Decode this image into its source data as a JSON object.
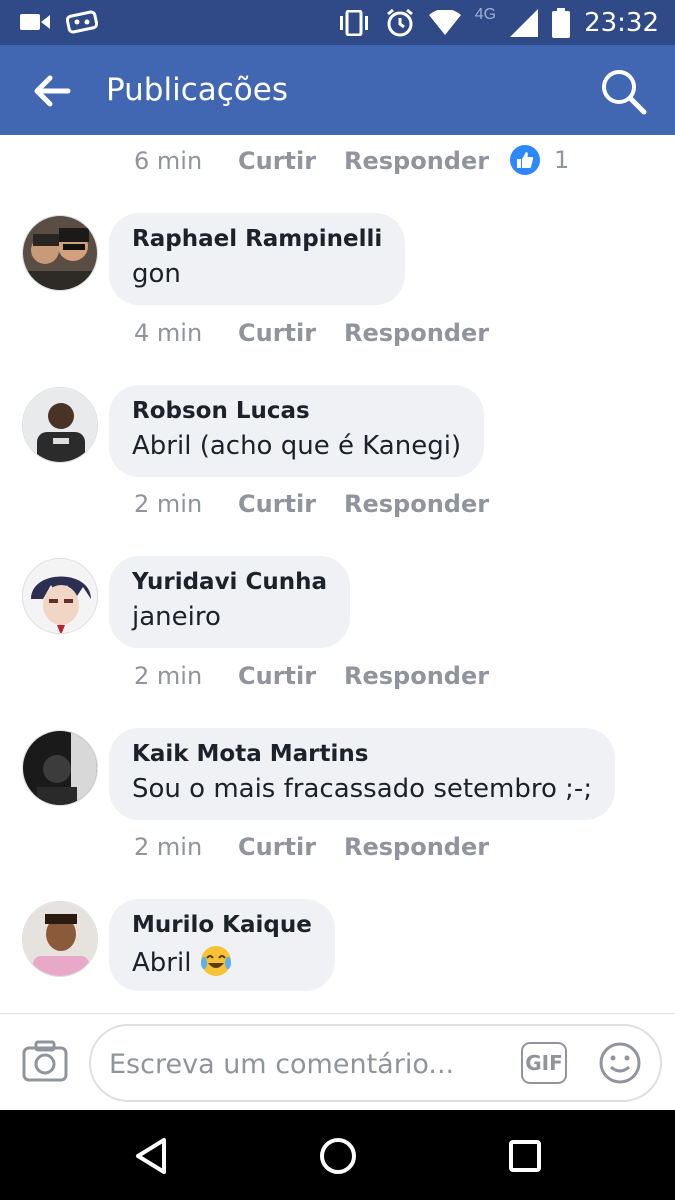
{
  "status_bar": {
    "time": "23:32",
    "network": "4G",
    "icons": [
      "video-camera-icon",
      "game-controller-icon",
      "vibrate-icon",
      "alarm-icon",
      "wifi-icon",
      "cell-signal-icon",
      "battery-icon"
    ]
  },
  "app_bar": {
    "title": "Publicações",
    "background": "#4267b2"
  },
  "top_meta": {
    "time": "6 min",
    "like_label": "Curtir",
    "reply_label": "Responder",
    "reaction_count": "1"
  },
  "comments": [
    {
      "author": "Raphael Rampinelli",
      "text": "gon",
      "time": "4 min",
      "like_label": "Curtir",
      "reply_label": "Responder"
    },
    {
      "author": "Robson Lucas",
      "text": "Abril (acho que é Kanegi)",
      "time": "2 min",
      "like_label": "Curtir",
      "reply_label": "Responder"
    },
    {
      "author": "Yuridavi Cunha",
      "text": "janeiro",
      "time": "2 min",
      "like_label": "Curtir",
      "reply_label": "Responder"
    },
    {
      "author": "Kaik Mota Martins",
      "text": "Sou o mais fracassado setembro ;-;",
      "time": "2 min",
      "like_label": "Curtir",
      "reply_label": "Responder"
    },
    {
      "author": "Murilo Kaique",
      "text": "Abril",
      "emoji": "laughing-tears-emoji"
    }
  ],
  "composer": {
    "placeholder": "Escreva um comentário...",
    "gif_label": "GIF"
  },
  "colors": {
    "status_bar": "#2f4a86",
    "accent": "#4267b2",
    "bubble": "#f0f1f4",
    "meta_text": "#90949c",
    "like_badge": "#2d88ff"
  }
}
